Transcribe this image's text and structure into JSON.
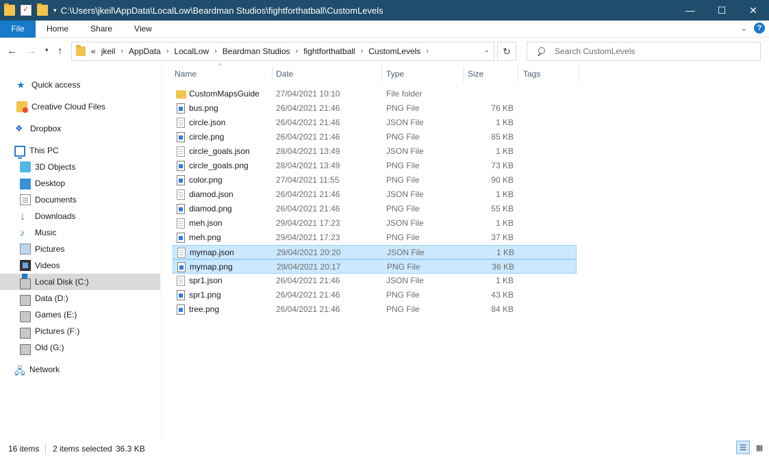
{
  "window": {
    "title": "C:\\Users\\jkeil\\AppData\\LocalLow\\Beardman Studios\\fightforthatball\\CustomLevels",
    "minimize_icon": "minimize-icon",
    "maximize_icon": "maximize-icon",
    "close_icon": "close-icon"
  },
  "ribbon": {
    "tabs": [
      {
        "label": "File"
      },
      {
        "label": "Home"
      },
      {
        "label": "Share"
      },
      {
        "label": "View"
      }
    ]
  },
  "address": {
    "overflow": "«",
    "crumbs": [
      "jkeil",
      "AppData",
      "LocalLow",
      "Beardman Studios",
      "fightforthatball",
      "CustomLevels"
    ],
    "search_placeholder": "Search CustomLevels"
  },
  "sidebar": {
    "items": [
      {
        "label": "Quick access",
        "icon": "star-icon"
      },
      {
        "label": "Creative Cloud Files",
        "icon": "creative-cloud-icon"
      },
      {
        "label": "Dropbox",
        "icon": "dropbox-icon"
      },
      {
        "label": "This PC",
        "icon": "computer-icon"
      },
      {
        "label": "3D Objects",
        "icon": "cube-icon"
      },
      {
        "label": "Desktop",
        "icon": "desktop-icon"
      },
      {
        "label": "Documents",
        "icon": "documents-icon"
      },
      {
        "label": "Downloads",
        "icon": "download-icon"
      },
      {
        "label": "Music",
        "icon": "music-icon"
      },
      {
        "label": "Pictures",
        "icon": "pictures-icon"
      },
      {
        "label": "Videos",
        "icon": "videos-icon"
      },
      {
        "label": "Local Disk (C:)",
        "icon": "drive-icon"
      },
      {
        "label": "Data (D:)",
        "icon": "drive-icon"
      },
      {
        "label": "Games (E:)",
        "icon": "drive-icon"
      },
      {
        "label": "Pictures (F:)",
        "icon": "drive-icon"
      },
      {
        "label": "Old (G:)",
        "icon": "drive-icon"
      },
      {
        "label": "Network",
        "icon": "network-icon"
      }
    ]
  },
  "columns": {
    "name": "Name",
    "date": "Date",
    "type": "Type",
    "size": "Size",
    "tags": "Tags"
  },
  "files": [
    {
      "name": "CustomMapsGuide",
      "date": "27/04/2021 10:10",
      "type": "File folder",
      "size": "",
      "kind": "folder",
      "selected": false
    },
    {
      "name": "bus.png",
      "date": "26/04/2021 21:46",
      "type": "PNG File",
      "size": "76 KB",
      "kind": "png",
      "selected": false
    },
    {
      "name": "circle.json",
      "date": "26/04/2021 21:46",
      "type": "JSON File",
      "size": "1 KB",
      "kind": "json",
      "selected": false
    },
    {
      "name": "circle.png",
      "date": "26/04/2021 21:46",
      "type": "PNG File",
      "size": "85 KB",
      "kind": "png",
      "selected": false
    },
    {
      "name": "circle_goals.json",
      "date": "28/04/2021 13:49",
      "type": "JSON File",
      "size": "1 KB",
      "kind": "json",
      "selected": false
    },
    {
      "name": "circle_goals.png",
      "date": "28/04/2021 13:49",
      "type": "PNG File",
      "size": "73 KB",
      "kind": "png",
      "selected": false
    },
    {
      "name": "color.png",
      "date": "27/04/2021 11:55",
      "type": "PNG File",
      "size": "90 KB",
      "kind": "png",
      "selected": false
    },
    {
      "name": "diamod.json",
      "date": "26/04/2021 21:46",
      "type": "JSON File",
      "size": "1 KB",
      "kind": "json",
      "selected": false
    },
    {
      "name": "diamod.png",
      "date": "26/04/2021 21:46",
      "type": "PNG File",
      "size": "55 KB",
      "kind": "png",
      "selected": false
    },
    {
      "name": "meh.json",
      "date": "29/04/2021 17:23",
      "type": "JSON File",
      "size": "1 KB",
      "kind": "json",
      "selected": false
    },
    {
      "name": "meh.png",
      "date": "29/04/2021 17:23",
      "type": "PNG File",
      "size": "37 KB",
      "kind": "png",
      "selected": false
    },
    {
      "name": "mymap.json",
      "date": "29/04/2021 20:20",
      "type": "JSON File",
      "size": "1 KB",
      "kind": "json",
      "selected": true
    },
    {
      "name": "mymap.png",
      "date": "29/04/2021 20:17",
      "type": "PNG File",
      "size": "36 KB",
      "kind": "png",
      "selected": true
    },
    {
      "name": "spr1.json",
      "date": "26/04/2021 21:46",
      "type": "JSON File",
      "size": "1 KB",
      "kind": "json",
      "selected": false
    },
    {
      "name": "spr1.png",
      "date": "26/04/2021 21:46",
      "type": "PNG File",
      "size": "43 KB",
      "kind": "png",
      "selected": false
    },
    {
      "name": "tree.png",
      "date": "26/04/2021 21:46",
      "type": "PNG File",
      "size": "84 KB",
      "kind": "png",
      "selected": false
    }
  ],
  "status": {
    "item_count": "16 items",
    "selected": "2 items selected",
    "selected_size": "36.3 KB"
  },
  "colors": {
    "titlebar": "#1f4d6b",
    "file_tab": "#1979ca",
    "selection": "#cce8ff",
    "selection_border": "#99d1ff"
  }
}
